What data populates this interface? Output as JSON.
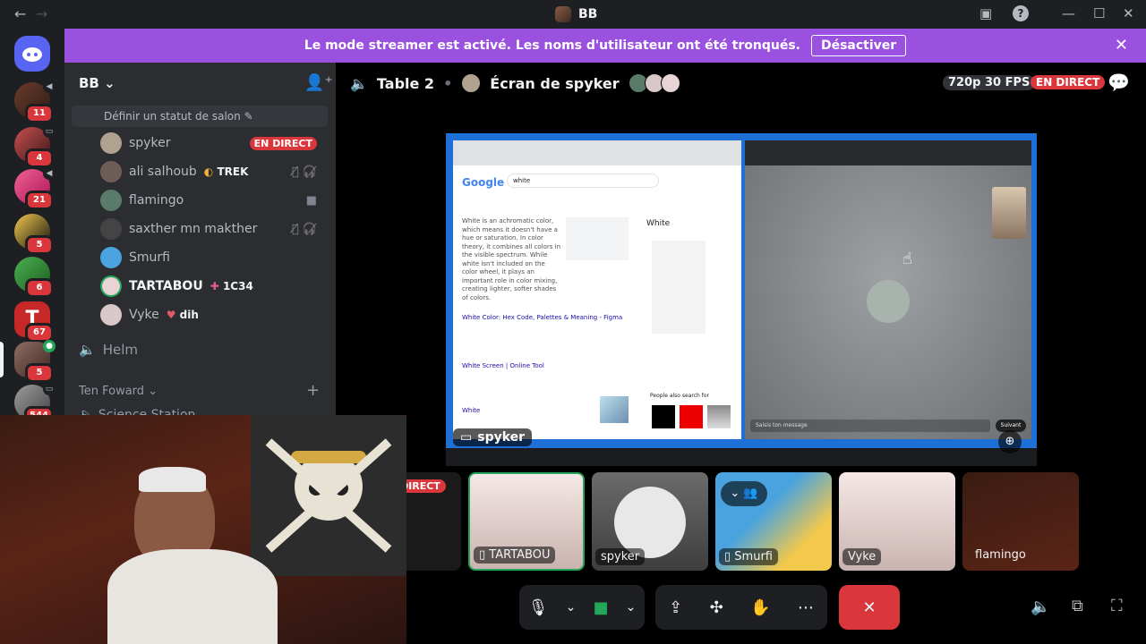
{
  "titlebar": {
    "title": "BB",
    "back": "←",
    "forward": "→"
  },
  "banner": {
    "message": "Le mode streamer est activé. Les noms d'utilisateur ont été tronqués.",
    "button": "Désactiver",
    "close": "✕"
  },
  "guilds": [
    {
      "badge": "11"
    },
    {
      "badge": "4"
    },
    {
      "badge": "21"
    },
    {
      "badge": "5"
    },
    {
      "badge": "6"
    },
    {
      "badge": "67"
    },
    {
      "badge": "5"
    },
    {
      "badge": "544"
    }
  ],
  "sidebar": {
    "server_name": "BB",
    "status_prompt": "Définir un statut de salon",
    "voice_users": [
      {
        "name": "spyker",
        "live": "EN DIRECT"
      },
      {
        "name": "ali salhoub",
        "tag": "TREK"
      },
      {
        "name": "flamingo"
      },
      {
        "name": "saxther mn makther"
      },
      {
        "name": "Smurfi"
      },
      {
        "name": "TARTABOU",
        "tag": "1C34"
      },
      {
        "name": "Vyke",
        "tag": "dih"
      }
    ],
    "channel_helm": "Helm",
    "category": "Ten Foward",
    "cut_channel": "Science Station"
  },
  "stage": {
    "channel": "Table 2",
    "stream_title": "Écran de spyker",
    "quality": "720p 30 FPS",
    "live": "EN DIRECT",
    "streamer_label": "spyker"
  },
  "stream_content": {
    "search_query": "white",
    "answer": "White is an achromatic color, which means it doesn't have a hue or saturation. In color theory, it combines all colors in the visible spectrum. While white isn't included on the color wheel, it plays an important role in color mixing, creating lighter, softer shades of colors.",
    "link1": "White Color: Hex Code, Palettes & Meaning - Figma",
    "link2": "White Screen | Online Tool",
    "link3": "White",
    "panel_title": "White",
    "people_also": "People also search for",
    "chat_placeholder": "Saisis ton message",
    "next": "Suivant"
  },
  "tiles": [
    {
      "name": "DIRECT"
    },
    {
      "name": "TARTABOU"
    },
    {
      "name": "spyker"
    },
    {
      "name": "Smurfi"
    },
    {
      "name": "Vyke"
    },
    {
      "name": "flamingo"
    }
  ],
  "colors": {
    "banner": "#9b51e0",
    "live": "#da373c",
    "end_call": "#da373c",
    "camera_on": "#23a55a"
  }
}
